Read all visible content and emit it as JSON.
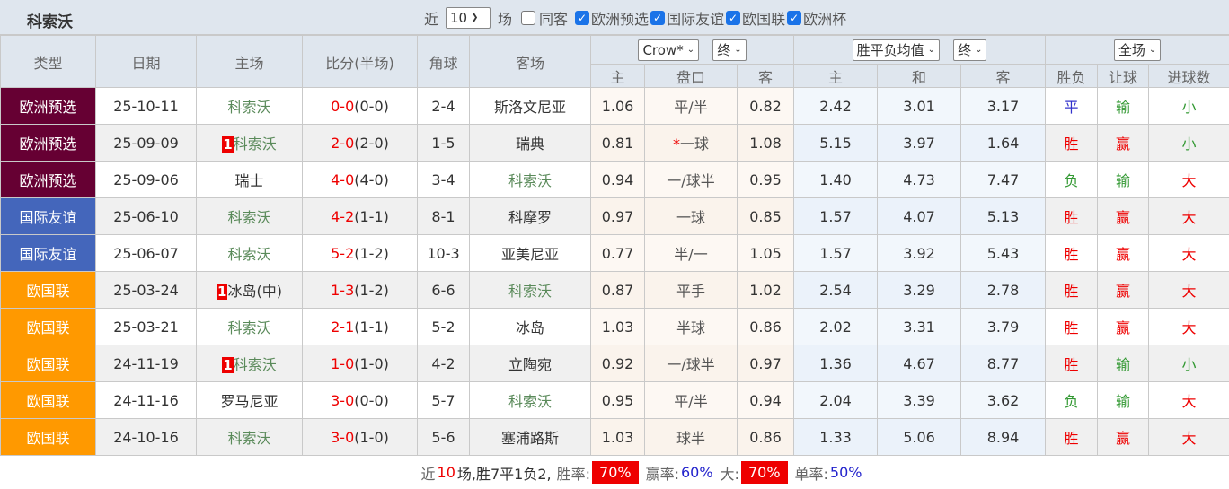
{
  "header": {
    "team": "科索沃",
    "near_label": "近",
    "count_value": "10",
    "field_label": "场",
    "same_host_label": "同客",
    "same_host_checked": false,
    "competitions": [
      {
        "label": "欧洲预选",
        "checked": true
      },
      {
        "label": "国际友谊",
        "checked": true
      },
      {
        "label": "欧国联",
        "checked": true
      },
      {
        "label": "欧洲杯",
        "checked": true
      }
    ]
  },
  "columns": {
    "type": "类型",
    "date": "日期",
    "home": "主场",
    "score": "比分(半场)",
    "corner": "角球",
    "away": "客场",
    "company_select": "Crow*",
    "handicap_stage_select": "终",
    "europe_select": "胜平负均值",
    "europe_stage_select": "终",
    "period_select": "全场",
    "sub": [
      "主",
      "盘口",
      "客",
      "主",
      "和",
      "客",
      "胜负",
      "让球",
      "进球数"
    ]
  },
  "type_colors": {
    "欧洲预选": "#660033",
    "国际友谊": "#4466bb",
    "欧国联": "#ff9900"
  },
  "result_colors": {
    "胜": "#ee0000",
    "赢": "#ee0000",
    "大": "#ee0000",
    "平": "#3333cc",
    "负": "#339933",
    "输": "#339933",
    "小": "#339933"
  },
  "rows": [
    {
      "type": "欧洲预选",
      "date": "25-10-11",
      "home": "科索沃",
      "home_rank": "",
      "score": "0-0",
      "half": "(0-0)",
      "corner": "2-4",
      "away": "斯洛文尼亚",
      "h_home": "1.06",
      "handicap": "平/半",
      "handicap_star": "",
      "h_away": "0.82",
      "e_home": "2.42",
      "e_draw": "3.01",
      "e_away": "3.17",
      "wdl": "平",
      "ah": "输",
      "ou": "小"
    },
    {
      "type": "欧洲预选",
      "date": "25-09-09",
      "home": "科索沃",
      "home_rank": "1",
      "score": "2-0",
      "half": "(2-0)",
      "corner": "1-5",
      "away": "瑞典",
      "h_home": "0.81",
      "handicap": "一球",
      "handicap_star": "*",
      "h_away": "1.08",
      "e_home": "5.15",
      "e_draw": "3.97",
      "e_away": "1.64",
      "wdl": "胜",
      "ah": "赢",
      "ou": "小"
    },
    {
      "type": "欧洲预选",
      "date": "25-09-06",
      "home": "瑞士",
      "home_rank": "",
      "score": "4-0",
      "half": "(4-0)",
      "corner": "3-4",
      "away": "科索沃",
      "h_home": "0.94",
      "handicap": "一/球半",
      "handicap_star": "",
      "h_away": "0.95",
      "e_home": "1.40",
      "e_draw": "4.73",
      "e_away": "7.47",
      "wdl": "负",
      "ah": "输",
      "ou": "大"
    },
    {
      "type": "国际友谊",
      "date": "25-06-10",
      "home": "科索沃",
      "home_rank": "",
      "score": "4-2",
      "half": "(1-1)",
      "corner": "8-1",
      "away": "科摩罗",
      "h_home": "0.97",
      "handicap": "一球",
      "handicap_star": "",
      "h_away": "0.85",
      "e_home": "1.57",
      "e_draw": "4.07",
      "e_away": "5.13",
      "wdl": "胜",
      "ah": "赢",
      "ou": "大"
    },
    {
      "type": "国际友谊",
      "date": "25-06-07",
      "home": "科索沃",
      "home_rank": "",
      "score": "5-2",
      "half": "(1-2)",
      "corner": "10-3",
      "away": "亚美尼亚",
      "h_home": "0.77",
      "handicap": "半/一",
      "handicap_star": "",
      "h_away": "1.05",
      "e_home": "1.57",
      "e_draw": "3.92",
      "e_away": "5.43",
      "wdl": "胜",
      "ah": "赢",
      "ou": "大"
    },
    {
      "type": "欧国联",
      "date": "25-03-24",
      "home": "冰岛(中)",
      "home_rank": "1",
      "score": "1-3",
      "half": "(1-2)",
      "corner": "6-6",
      "away": "科索沃",
      "h_home": "0.87",
      "handicap": "平手",
      "handicap_star": "",
      "h_away": "1.02",
      "e_home": "2.54",
      "e_draw": "3.29",
      "e_away": "2.78",
      "wdl": "胜",
      "ah": "赢",
      "ou": "大"
    },
    {
      "type": "欧国联",
      "date": "25-03-21",
      "home": "科索沃",
      "home_rank": "",
      "score": "2-1",
      "half": "(1-1)",
      "corner": "5-2",
      "away": "冰岛",
      "h_home": "1.03",
      "handicap": "半球",
      "handicap_star": "",
      "h_away": "0.86",
      "e_home": "2.02",
      "e_draw": "3.31",
      "e_away": "3.79",
      "wdl": "胜",
      "ah": "赢",
      "ou": "大"
    },
    {
      "type": "欧国联",
      "date": "24-11-19",
      "home": "科索沃",
      "home_rank": "1",
      "score": "1-0",
      "half": "(1-0)",
      "corner": "4-2",
      "away": "立陶宛",
      "h_home": "0.92",
      "handicap": "一/球半",
      "handicap_star": "",
      "h_away": "0.97",
      "e_home": "1.36",
      "e_draw": "4.67",
      "e_away": "8.77",
      "wdl": "胜",
      "ah": "输",
      "ou": "小"
    },
    {
      "type": "欧国联",
      "date": "24-11-16",
      "home": "罗马尼亚",
      "home_rank": "",
      "score": "3-0",
      "half": "(0-0)",
      "corner": "5-7",
      "away": "科索沃",
      "h_home": "0.95",
      "handicap": "平/半",
      "handicap_star": "",
      "h_away": "0.94",
      "e_home": "2.04",
      "e_draw": "3.39",
      "e_away": "3.62",
      "wdl": "负",
      "ah": "输",
      "ou": "大"
    },
    {
      "type": "欧国联",
      "date": "24-10-16",
      "home": "科索沃",
      "home_rank": "",
      "score": "3-0",
      "half": "(1-0)",
      "corner": "5-6",
      "away": "塞浦路斯",
      "h_home": "1.03",
      "handicap": "球半",
      "handicap_star": "",
      "h_away": "0.86",
      "e_home": "1.33",
      "e_draw": "5.06",
      "e_away": "8.94",
      "wdl": "胜",
      "ah": "赢",
      "ou": "大"
    }
  ],
  "summary": {
    "near": "近",
    "count": "10",
    "record": "场,胜7平1负2,",
    "win_rate_label": "胜率:",
    "win_rate": "70%",
    "ah_rate_label": "赢率:",
    "ah_rate": "60%",
    "big_label": "大:",
    "big_rate": "70%",
    "odd_label": "单率:",
    "odd_rate": "50%"
  }
}
